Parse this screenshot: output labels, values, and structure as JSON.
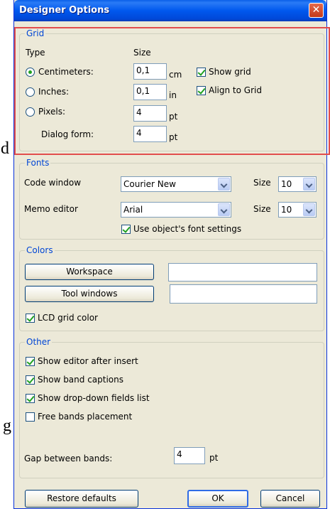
{
  "background": {
    "chars": [
      "d",
      "g"
    ]
  },
  "window": {
    "title": "Designer Options",
    "close_glyph": "✕"
  },
  "grid": {
    "title": "Grid",
    "type_label": "Type",
    "size_label": "Size",
    "options": [
      {
        "label": "Centimeters:",
        "value": "0,1",
        "unit": "cm",
        "selected": true
      },
      {
        "label": "Inches:",
        "value": "0,1",
        "unit": "in",
        "selected": false
      },
      {
        "label": "Pixels:",
        "value": "4",
        "unit": "pt",
        "selected": false
      }
    ],
    "dialog_form": {
      "label": "Dialog form:",
      "value": "4",
      "unit": "pt"
    },
    "show_grid": {
      "label": "Show grid",
      "checked": true
    },
    "align_to_grid": {
      "label": "Align to Grid",
      "checked": true
    }
  },
  "fonts": {
    "title": "Fonts",
    "code_window": {
      "label": "Code window",
      "font": "Courier New",
      "size_label": "Size",
      "size": "10"
    },
    "memo_editor": {
      "label": "Memo editor",
      "font": "Arial",
      "size_label": "Size",
      "size": "10"
    },
    "use_object_font": {
      "label": "Use object's font settings",
      "checked": true
    }
  },
  "colors": {
    "title": "Colors",
    "workspace_button": "Workspace",
    "tool_windows_button": "Tool windows",
    "lcd_grid_color": {
      "label": "LCD grid color",
      "checked": true
    }
  },
  "other": {
    "title": "Other",
    "options": [
      {
        "label": "Show editor after insert",
        "checked": true
      },
      {
        "label": "Show band captions",
        "checked": true
      },
      {
        "label": "Show drop-down fields list",
        "checked": true
      },
      {
        "label": "Free bands placement",
        "checked": false
      }
    ],
    "gap": {
      "label": "Gap between bands:",
      "value": "4",
      "unit": "pt"
    }
  },
  "footer": {
    "restore_defaults": "Restore defaults",
    "ok": "OK",
    "cancel": "Cancel"
  },
  "colors_theme": {
    "highlight_border": "#e24d4d",
    "title_bar": "#0058ee",
    "group_title": "#0046d5"
  }
}
